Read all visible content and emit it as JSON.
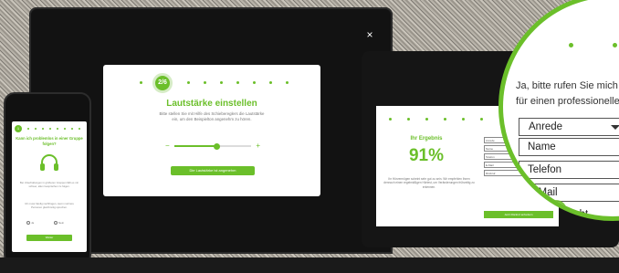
{
  "laptop_modal": {
    "step_indicator": "2/6",
    "title": "Lautstärke einstellen",
    "description": "Bitte stellen Sie mit Hilfe des Schiebereglers die Lautstärke ein, um den Beispielton angenehm zu hören.",
    "slider_minus": "−",
    "slider_plus": "+",
    "slider_value": 0.55,
    "continue_button": "Die Lautstärke ist angenehm",
    "close_label": "×"
  },
  "phone": {
    "step_indicator": "1",
    "title": "Kann ich problemlos in einer Gruppe folgen?",
    "text": "Bei Unterhaltungen in größeren Gruppen fällt es mir schwer, allen Gesprächen zu folgen.",
    "text2": "Ich muss häufig nachfragen, wenn mehrere Personen gleichzeitig sprechen.",
    "option_yes": "Ja",
    "option_no": "Nein",
    "button": "Weiter"
  },
  "tablet": {
    "result_title": "Ihr Ergebnis",
    "result_value": "91%",
    "result_text": "Ihr Hörvermögen scheint sehr gut zu sein. Wir empfehlen Ihnen dennoch einen regelmäßigen Hörtest, um Veränderungen frühzeitig zu erkennen.",
    "form_fields": [
      "Anrede",
      "Name",
      "Telefon",
      "E-Mail",
      "Rückruf"
    ],
    "form_button": "Jetzt Rückruf anfordern"
  },
  "magnifier": {
    "heading_line1": "Ja, bitte rufen Sie mich",
    "heading_line2": "für einen professionelle",
    "select_value": "Anrede",
    "field_name": "Name",
    "field_phone": "Telefon",
    "field_email": "E-Mail",
    "field_extra": "Nicht"
  },
  "colors": {
    "accent": "#6bbf2a",
    "device": "#121212"
  }
}
